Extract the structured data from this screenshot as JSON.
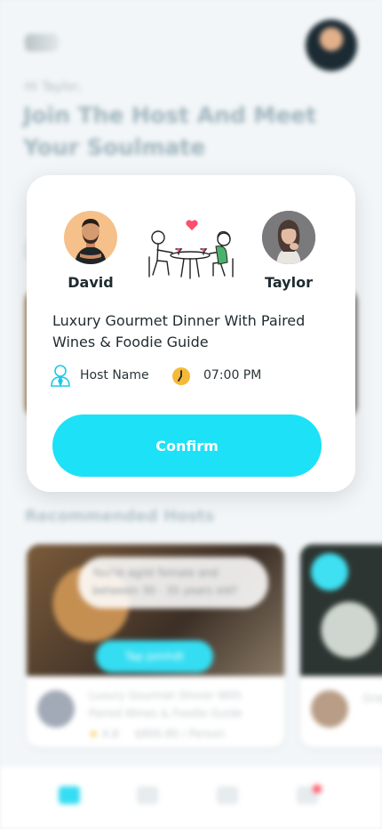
{
  "background": {
    "greeting": "Hi Taylor,",
    "title": "Join The Host And Meet Your Soulmate",
    "recommended_title": "Recommended Hosts",
    "card1": {
      "bubble_text": "You're ag/st female and between 30 - 35 years old?",
      "pill_label": "Tap Joinhdt",
      "event_title": "Luxury Gourmet Dinner With Paired Wines & Foodie Guide",
      "rating": "4.8",
      "price": "$800.80 / Person"
    },
    "card2": {
      "title_fragment": "Gratr"
    }
  },
  "modal": {
    "guest_left": {
      "name": "David"
    },
    "guest_right": {
      "name": "Taylor"
    },
    "event_title": "Luxury Gourmet Dinner With Paired Wines & Foodie Guide",
    "host_label": "Host Name",
    "time": "07:00 PM",
    "confirm_label": "Confirm",
    "accent_color": "#1de1f7",
    "host_icon": "user-tie-icon",
    "time_icon": "clock-icon"
  }
}
